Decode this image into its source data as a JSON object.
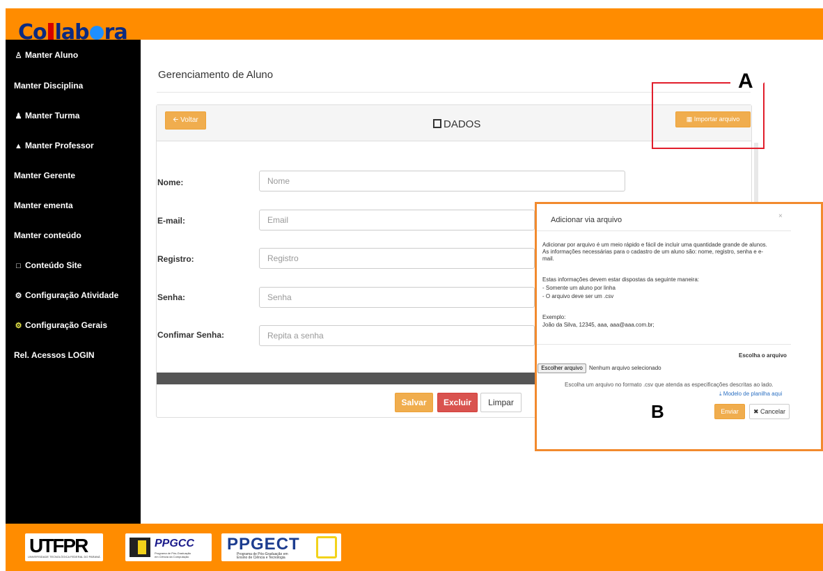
{
  "brand": {
    "logo_pre": "Co",
    "logo_mid": "lab",
    "logo_post": "ra"
  },
  "sidebar": {
    "items": [
      {
        "label": "Manter Aluno",
        "icon": "user-icon"
      },
      {
        "label": "Manter Disciplina"
      },
      {
        "label": "Manter Turma",
        "icon": "users-icon"
      },
      {
        "label": "Manter Professor",
        "icon": "graduation-cap-icon"
      },
      {
        "label": "Manter Gerente"
      },
      {
        "label": "Manter ementa"
      },
      {
        "label": "Manter conteúdo"
      },
      {
        "label": "Conteúdo Site",
        "icon": "square-icon"
      },
      {
        "label": "Configuração Atividade",
        "icon": "cog-icon"
      },
      {
        "label": "Configuração Gerais",
        "icon": "cog-icon"
      },
      {
        "label": "Rel. Acessos LOGIN"
      }
    ]
  },
  "main": {
    "page_title": "Gerenciamento de Aluno",
    "panel": {
      "back_label": "Voltar",
      "title": "DADOS",
      "import_label": "Importar arquivo"
    },
    "form": {
      "fields": [
        {
          "label": "Nome:",
          "placeholder": "Nome"
        },
        {
          "label": "E-mail:",
          "placeholder": "Email"
        },
        {
          "label": "Registro:",
          "placeholder": "Registro"
        },
        {
          "label": "Senha:",
          "placeholder": "Senha"
        },
        {
          "label": "Confimar Senha:",
          "placeholder": "Repita a senha"
        }
      ],
      "save_label": "Salvar",
      "delete_label": "Excluir",
      "clear_label": "Limpar"
    }
  },
  "annotations": {
    "a": "A",
    "b": "B"
  },
  "modal": {
    "title": "Adicionar via arquivo",
    "close": "×",
    "intro_line1": "Adicionar por arquivo é um meio rápido e fácil de incluir uma quantidade grande de alunos.",
    "intro_line2": "As informações necessárias para o cadastro de um aluno são: nome, registro, senha e e-",
    "intro_line3": "mail.",
    "rules_title": "Estas informações devem estar dispostas da seguinte maneira:",
    "rule1": "- Somente um aluno por linha",
    "rule2": "- O arquivo deve ser um .csv",
    "example_title": "Exemplo:",
    "example": "João da Silva, 12345, aaa, aaa@aaa.com.br;",
    "choose_label": "Escolha o arquivo",
    "file_button": "Escolher arquivo",
    "file_status": "Nenhum arquivo selecionado",
    "file_hint": "Escolha um arquivo no formato .csv que atenda as especificações descritas ao lado.",
    "template_link": "Modelo de planilha aqui",
    "send_label": "Enviar",
    "cancel_label": "Cancelar"
  },
  "footer": {
    "utfpr_title": "UTFPR",
    "utfpr_sub": "UNIVERSIDADE TECNOLÓGICA FEDERAL DO PARANÁ",
    "ppgcc_title": "PPGCC",
    "ppgcc_sub1": "Programa de Pós-Graduação",
    "ppgcc_sub2": "em Ciência da Computação",
    "ppgect_title": "PPGECT",
    "ppgect_sub1": "Programa de Pós-Graduação em",
    "ppgect_sub2": "Ensino de Ciência e Tecnologia"
  },
  "colors": {
    "accent": "#ff8c00",
    "sidebar": "#000000",
    "warning": "#f0ad4e",
    "danger": "#d9534f",
    "annotation_red": "#e11d2b",
    "annotation_orange": "#f28a2e"
  }
}
